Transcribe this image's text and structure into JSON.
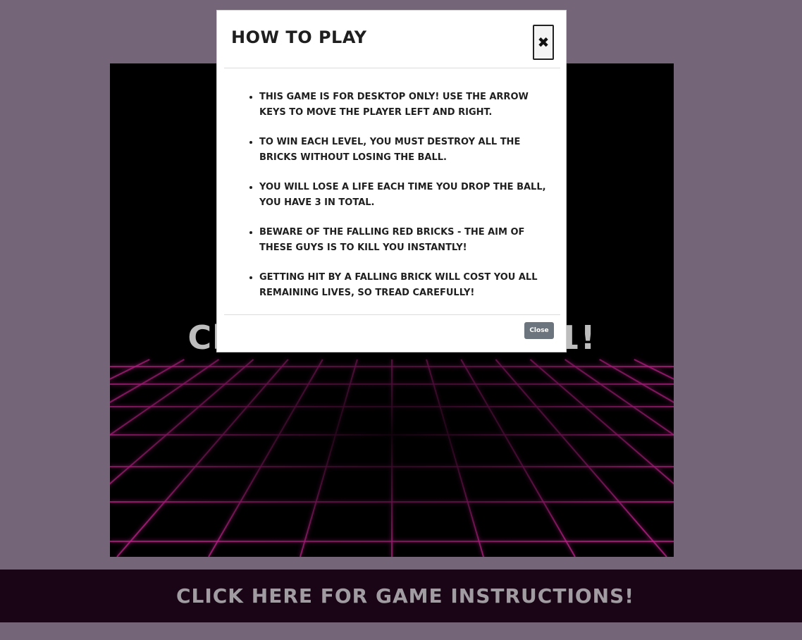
{
  "game": {
    "message": "Click to start Level 1!"
  },
  "modal": {
    "title": "HOW TO PLAY",
    "close_icon": "✖",
    "rules": [
      "THIS GAME IS FOR DESKTOP ONLY! USE THE ARROW KEYS TO MOVE THE PLAYER LEFT AND RIGHT.",
      "TO WIN EACH LEVEL, YOU MUST DESTROY ALL THE BRICKS WITHOUT LOSING THE BALL.",
      "YOU WILL LOSE A LIFE EACH TIME YOU DROP THE BALL, YOU HAVE 3 IN TOTAL.",
      "BEWARE OF THE FALLING RED BRICKS - THE AIM OF THESE GUYS IS TO KILL YOU INSTANTLY!",
      "GETTING HIT BY A FALLING BRICK WILL COST YOU ALL REMAINING LIVES, SO TREAD CAREFULLY!"
    ],
    "close_button": "Close"
  },
  "footer": {
    "instructions_link": "CLICK HERE FOR GAME INSTRUCTIONS!"
  },
  "colors": {
    "page_background": "#756578",
    "grid_glow": "#c0208c",
    "footer_bar": "#1a0516",
    "close_button": "#6c757d"
  }
}
